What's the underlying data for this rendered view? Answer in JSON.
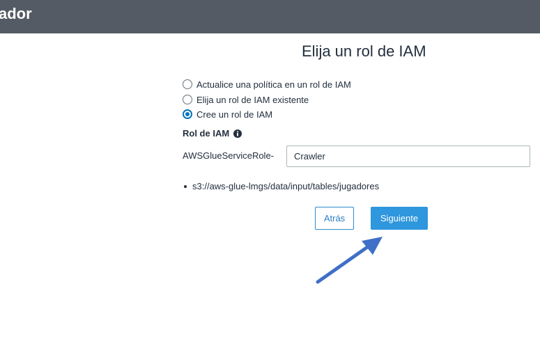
{
  "header": {
    "title": "ador"
  },
  "page": {
    "title": "Elija un rol de IAM"
  },
  "options": {
    "items": [
      {
        "label": "Actualice una política en un rol de IAM",
        "selected": false
      },
      {
        "label": "Elija un rol de IAM existente",
        "selected": false
      },
      {
        "label": "Cree un rol de IAM",
        "selected": true
      }
    ]
  },
  "role": {
    "label": "Rol de IAM",
    "info_icon": "info-circle-icon",
    "prefix": "AWSGlueServiceRole-",
    "value": "Crawler"
  },
  "resources": {
    "paths": [
      "s3://aws-glue-lmgs/data/input/tables/jugadores"
    ]
  },
  "buttons": {
    "back_label": "Atrás",
    "next_label": "Siguiente"
  },
  "colors": {
    "header_bg": "#545b64",
    "primary": "#2e97dd",
    "radio_selected": "#0073bb",
    "annotation_arrow": "#3f6fc7"
  }
}
